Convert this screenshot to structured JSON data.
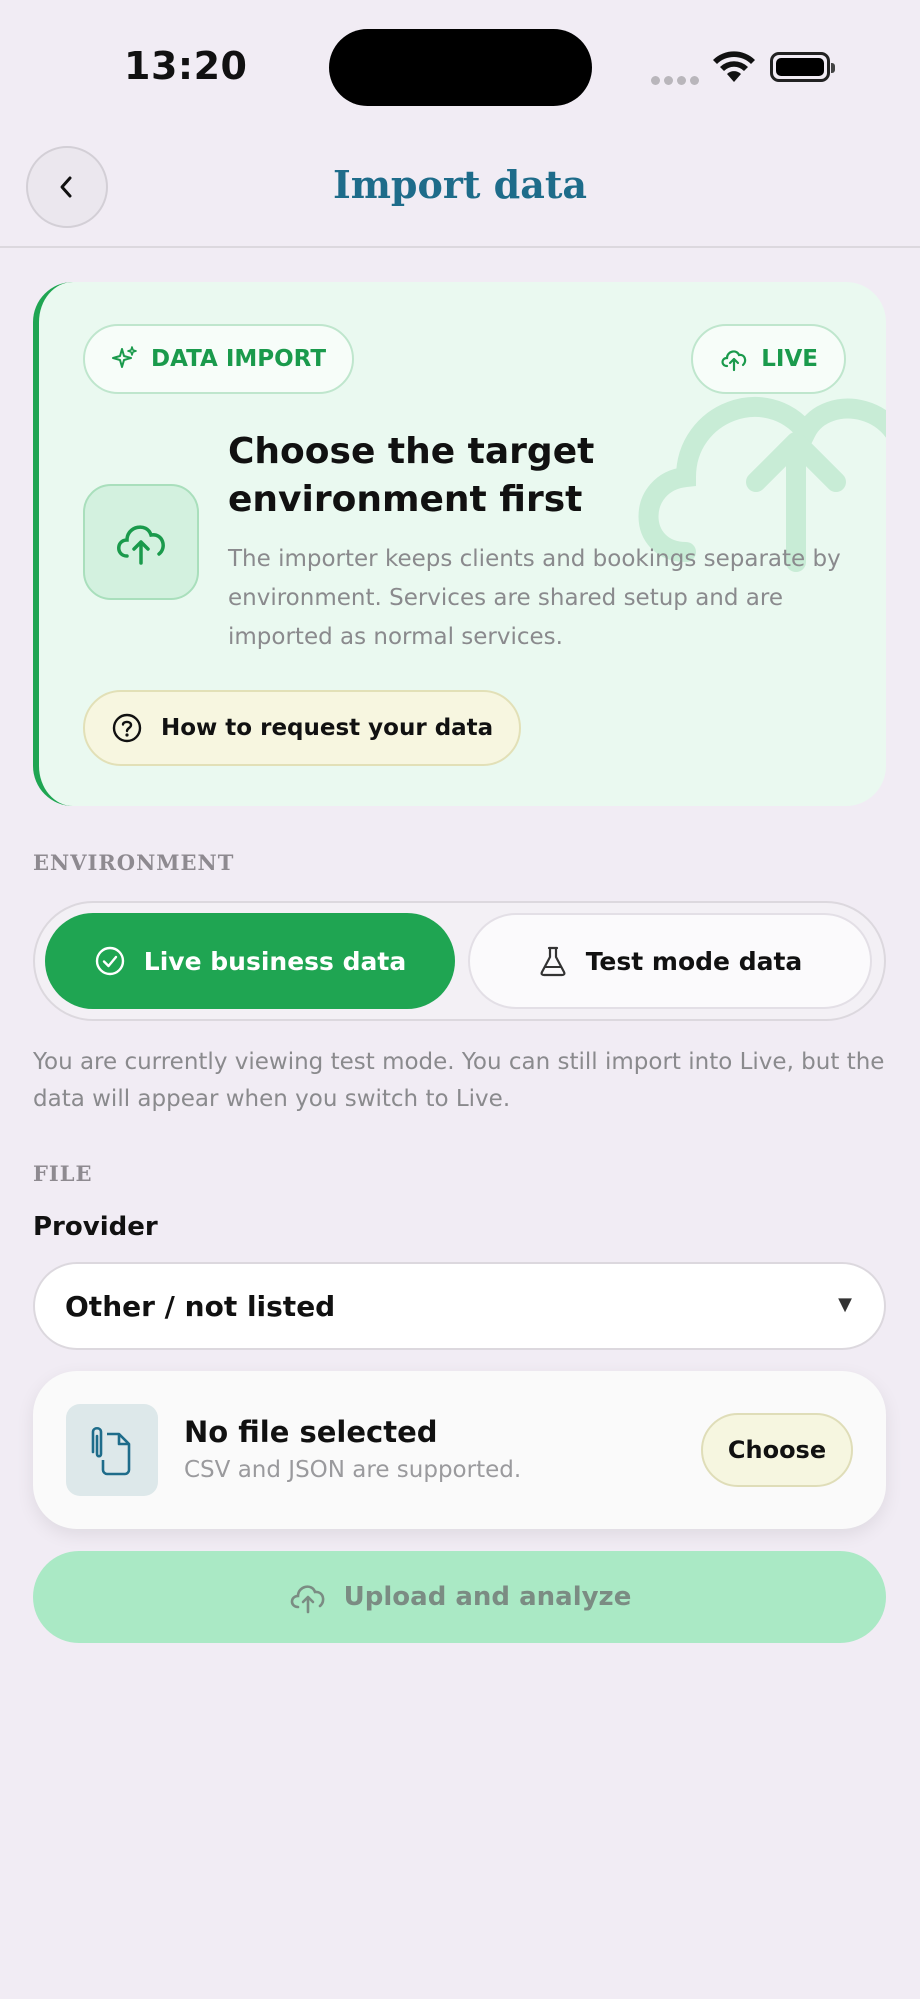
{
  "status_bar": {
    "time": "13:20"
  },
  "header": {
    "title": "Import data"
  },
  "hero": {
    "chip_import": "DATA IMPORT",
    "chip_live": "LIVE",
    "title": "Choose the target environment first",
    "description": "The importer keeps clients and bookings separate by environment. Services are shared setup and are imported as normal services.",
    "request_button": "How to request your data"
  },
  "environment": {
    "section_label": "ENVIRONMENT",
    "options": [
      {
        "label": "Live business data",
        "selected": true
      },
      {
        "label": "Test mode data",
        "selected": false
      }
    ],
    "note": "You are currently viewing test mode. You can still import into Live, but the data will appear when you switch to Live."
  },
  "file": {
    "section_label": "FILE",
    "provider_label": "Provider",
    "provider_value": "Other / not listed",
    "file_title": "No file selected",
    "file_subtitle": "CSV and JSON are supported.",
    "choose_button": "Choose",
    "upload_button": "Upload and analyze"
  },
  "colors": {
    "accent_green": "#1fa552",
    "title_blue": "#1e6c8a",
    "background": "#f1ecf4"
  }
}
